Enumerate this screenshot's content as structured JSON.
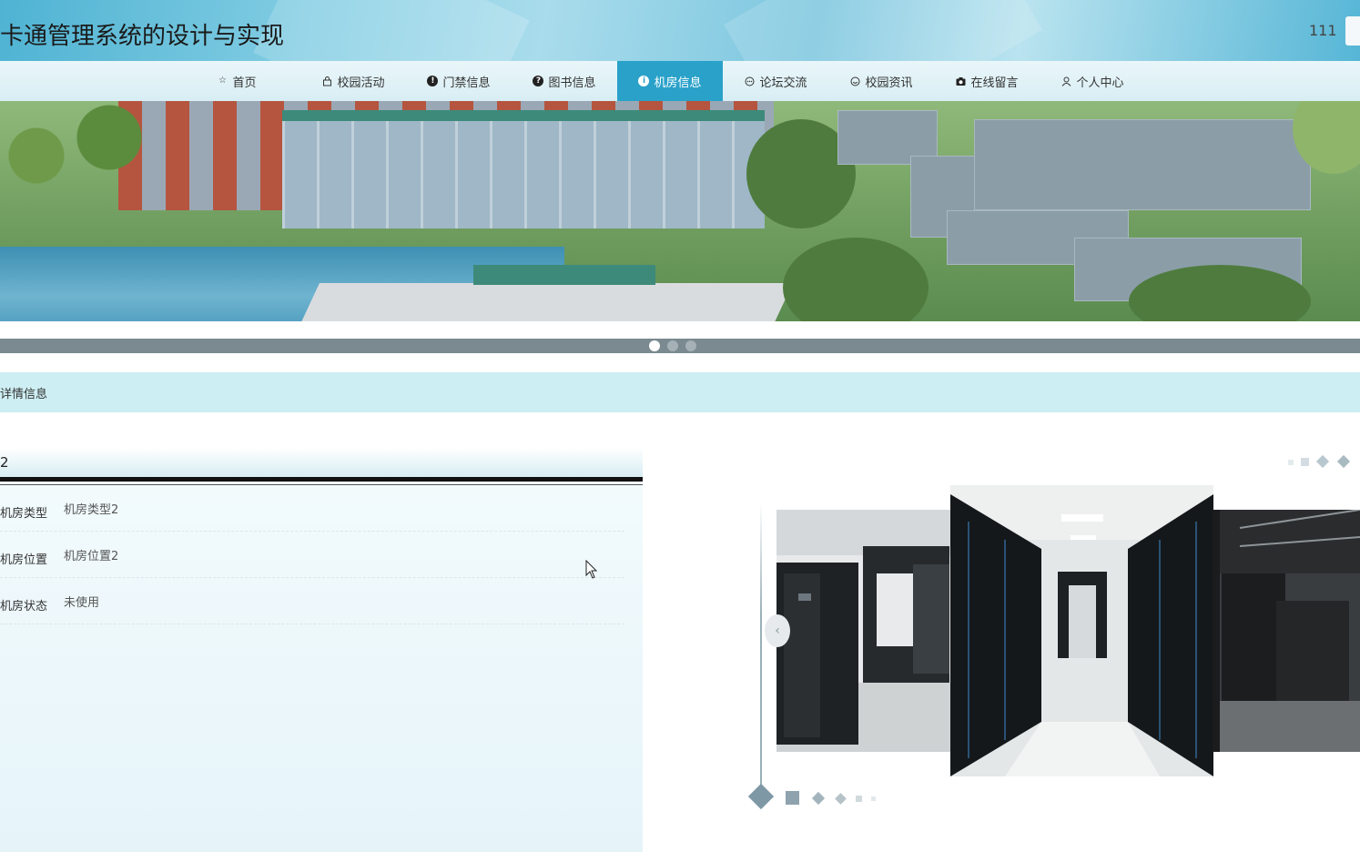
{
  "header": {
    "site_title": "卡通管理系统的设计与实现",
    "user_name": "111"
  },
  "nav": {
    "items": [
      {
        "label": "首页",
        "icon": "star-outline-icon"
      },
      {
        "label": "校园活动",
        "icon": "bag-icon"
      },
      {
        "label": "门禁信息",
        "icon": "exclamation-circle-icon"
      },
      {
        "label": "图书信息",
        "icon": "question-circle-icon"
      },
      {
        "label": "机房信息",
        "icon": "info-circle-icon"
      },
      {
        "label": "论坛交流",
        "icon": "chat-icon"
      },
      {
        "label": "校园资讯",
        "icon": "smile-icon"
      },
      {
        "label": "在线留言",
        "icon": "camera-icon"
      },
      {
        "label": "个人中心",
        "icon": "user-icon"
      }
    ],
    "active_index": 4
  },
  "carousel": {
    "slide_count": 3,
    "active_slide": 0
  },
  "section": {
    "title": "详情信息"
  },
  "detail": {
    "name": "2",
    "rows": [
      {
        "label": "机房类型",
        "value": "机房类型2"
      },
      {
        "label": "机房位置",
        "value": "机房位置2"
      },
      {
        "label": "机房状态",
        "value": "未使用"
      }
    ]
  },
  "colors": {
    "nav_active": "#2aa1c9",
    "section_bar": "#cdeef2"
  }
}
